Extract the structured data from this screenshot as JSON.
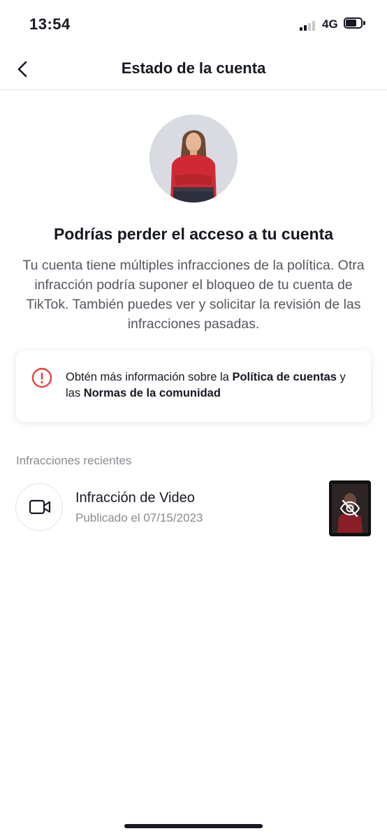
{
  "status_bar": {
    "time": "13:54",
    "network": "4G"
  },
  "nav": {
    "title": "Estado de la cuenta"
  },
  "hero": {
    "headline": "Podrías perder el acceso a tu cuenta",
    "description": "Tu cuenta tiene múltiples infracciones de la política. Otra infracción podría suponer el bloqueo de tu cuenta de TikTok. También puedes ver y solicitar la revisión de las infracciones pasadas."
  },
  "info_card": {
    "text_1": "Obtén más información sobre la ",
    "link_1": "Política de cuentas",
    "text_2": " y las ",
    "link_2": "Normas de la comunidad"
  },
  "recent": {
    "section_title": "Infracciones recientes",
    "items": [
      {
        "title": "Infracción de Video",
        "subtitle": "Publicado el 07/15/2023"
      }
    ]
  },
  "colors": {
    "warning": "#e8413b",
    "text": "#161823",
    "muted": "#8a8b91"
  }
}
